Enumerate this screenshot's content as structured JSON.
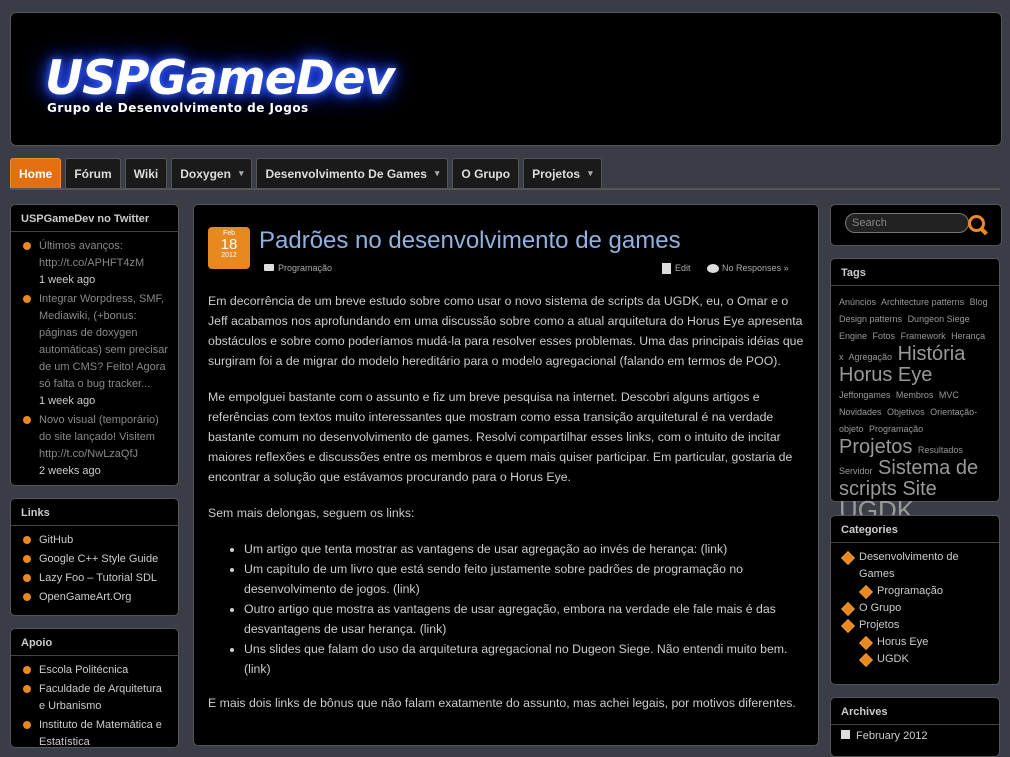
{
  "header": {
    "logo": "USPGameDev",
    "tagline": "Grupo de Desenvolvimento de Jogos"
  },
  "nav": [
    {
      "label": "Home",
      "active": true,
      "caret": false
    },
    {
      "label": "Fórum",
      "active": false,
      "caret": false
    },
    {
      "label": "Wiki",
      "active": false,
      "caret": false
    },
    {
      "label": "Doxygen",
      "active": false,
      "caret": true
    },
    {
      "label": "Desenvolvimento De Games",
      "active": false,
      "caret": true
    },
    {
      "label": "O Grupo",
      "active": false,
      "caret": false
    },
    {
      "label": "Projetos",
      "active": false,
      "caret": true
    }
  ],
  "twitter": {
    "title": "USPGameDev no Twitter",
    "items": [
      {
        "text": "Últimos avanços: http://t.co/APHFT4zM",
        "time": "1 week ago"
      },
      {
        "text": "Integrar Worpdress, SMF, Mediawiki, (+bonus: páginas de doxygen automáticas) sem precisar de um CMS? Feito! Agora só falta o bug tracker...",
        "time": "1 week ago"
      },
      {
        "text": "Novo visual (temporário) do site lançado! Visitem http://t.co/NwLzaQfJ",
        "time": "2 weeks ago"
      }
    ]
  },
  "links": {
    "title": "Links",
    "items": [
      "GitHub",
      "Google C++ Style Guide",
      "Lazy Foo – Tutorial SDL",
      "OpenGameArt.Org"
    ]
  },
  "apoio": {
    "title": "Apoio",
    "items": [
      "Escola Politécnica",
      "Faculdade de Arquitetura e Urbanismo",
      "Instituto de Matemática e Estatística"
    ]
  },
  "post": {
    "date_month": "Feb",
    "date_day": "18",
    "date_year": "2012",
    "title": "Padrões no desenvolvimento de games",
    "category": "Programação",
    "edit": "Edit",
    "responses": "No Responses »",
    "p1": "Em decorrência de um breve estudo sobre como usar o novo sistema de scripts da UGDK, eu, o Omar e o Jeff acabamos nos aprofundando em uma discussão sobre como a atual arquitetura do Horus Eye apresenta obstáculos e sobre como poderíamos mudá-la para resolver esses problemas. Uma das principais idéias que surgiram foi a de migrar do modelo hereditário para o modelo agregacional (falando em termos de POO).",
    "p2": "Me empolguei bastante com o assunto e fiz um breve pesquisa na internet. Descobri alguns artigos e referências com textos muito interessantes que mostram como essa transição arquitetural é na verdade bastante comum no desenvolvimento de games. Resolvi compartilhar esses links, com o intuito de incitar maiores reflexões e discussões entre os membros e quem mais quiser participar. Em particular, gostaria de encontrar a solução que estávamos procurando para o Horus Eye.",
    "p3": "Sem mais delongas, seguem os links:",
    "list": [
      "Um artigo que tenta mostrar as vantagens de usar agregação ao invés de herança: (link)",
      "Um capítulo de um livro que está sendo feito justamente sobre padrões de programação no desenvolvimento de jogos. (link)",
      "Outro artigo que mostra as vantagens de usar agregação, embora na verdade ele fale mais é das desvantagens de usar herança. (link)",
      "Uns slides que falam do uso da arquitetura agregacional no Dugeon Siege. Não entendi muito bem. (link)"
    ],
    "p4": "E mais dois links de bônus que não falam exatamente do assunto, mas achei legais, por motivos diferentes."
  },
  "search": {
    "placeholder": "Search"
  },
  "tags": {
    "title": "Tags",
    "items": [
      {
        "t": "Anúncios",
        "s": 9
      },
      {
        "t": "Architecture patterns",
        "s": 9
      },
      {
        "t": "Blog",
        "s": 9
      },
      {
        "t": "Design patterns",
        "s": 9
      },
      {
        "t": "Dungeon Siege",
        "s": 9
      },
      {
        "t": "Engine",
        "s": 9
      },
      {
        "t": "Fotos",
        "s": 9
      },
      {
        "t": "Framework",
        "s": 9
      },
      {
        "t": "Herança",
        "s": 9
      },
      {
        "t": "x",
        "s": 9
      },
      {
        "t": "Agregação",
        "s": 9
      },
      {
        "t": "História",
        "s": 20
      },
      {
        "t": "Horus Eye",
        "s": 20
      },
      {
        "t": "Jeffongames",
        "s": 9
      },
      {
        "t": "Membros",
        "s": 9
      },
      {
        "t": "MVC",
        "s": 9
      },
      {
        "t": "Novidades",
        "s": 9
      },
      {
        "t": "Objetivos",
        "s": 9
      },
      {
        "t": "Orientação-objeto",
        "s": 9
      },
      {
        "t": "Programação",
        "s": 9
      },
      {
        "t": "Projetos",
        "s": 20
      },
      {
        "t": "Resultados",
        "s": 9
      },
      {
        "t": "Servidor",
        "s": 9
      },
      {
        "t": "Sistema de scripts",
        "s": 20
      },
      {
        "t": "Site",
        "s": 20
      },
      {
        "t": "UGDK",
        "s": 26
      }
    ]
  },
  "categories": {
    "title": "Categories",
    "items": [
      {
        "label": "Desenvolvimento de Games",
        "sub": false
      },
      {
        "label": "Programação",
        "sub": true
      },
      {
        "label": "O Grupo",
        "sub": false
      },
      {
        "label": "Projetos",
        "sub": false
      },
      {
        "label": "Horus Eye",
        "sub": true
      },
      {
        "label": "UGDK",
        "sub": true
      }
    ]
  },
  "archives": {
    "title": "Archives",
    "first": "February 2012"
  }
}
